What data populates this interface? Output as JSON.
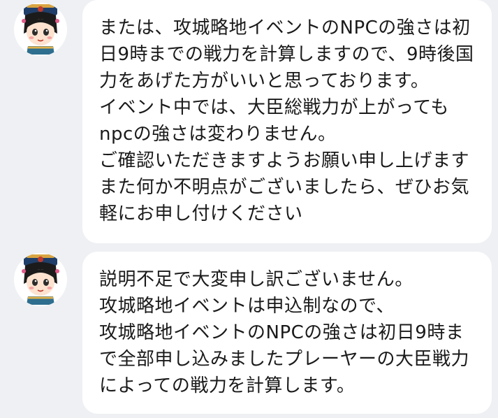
{
  "colors": {
    "background": "#eef0f3",
    "bubble": "#ffffff",
    "text": "#1a1a1a"
  },
  "messages": [
    {
      "avatar_icon": "chibi-girl-avatar-icon",
      "lines": [
        "または、攻城略地イベントのNPCの強さは初",
        "日9時までの戦力を計算しますので、9時後国",
        "力をあげた方がいいと思っております。",
        "イベント中では、大臣総戦力が上がっても",
        "npcの強さは変わりません。",
        "ご確認いただきますようお願い申し上げます",
        "また何か不明点がございましたら、ぜひお気",
        "軽にお申し付けください"
      ]
    },
    {
      "avatar_icon": "chibi-girl-avatar-icon",
      "lines": [
        "説明不足で大変申し訳ございません。",
        "攻城略地イベントは申込制なので、",
        "攻城略地イベントのNPCの強さは初日9時ま",
        "で全部申し込みましたプレーヤーの大臣戦力",
        "によっての戦力を計算します。"
      ]
    }
  ]
}
